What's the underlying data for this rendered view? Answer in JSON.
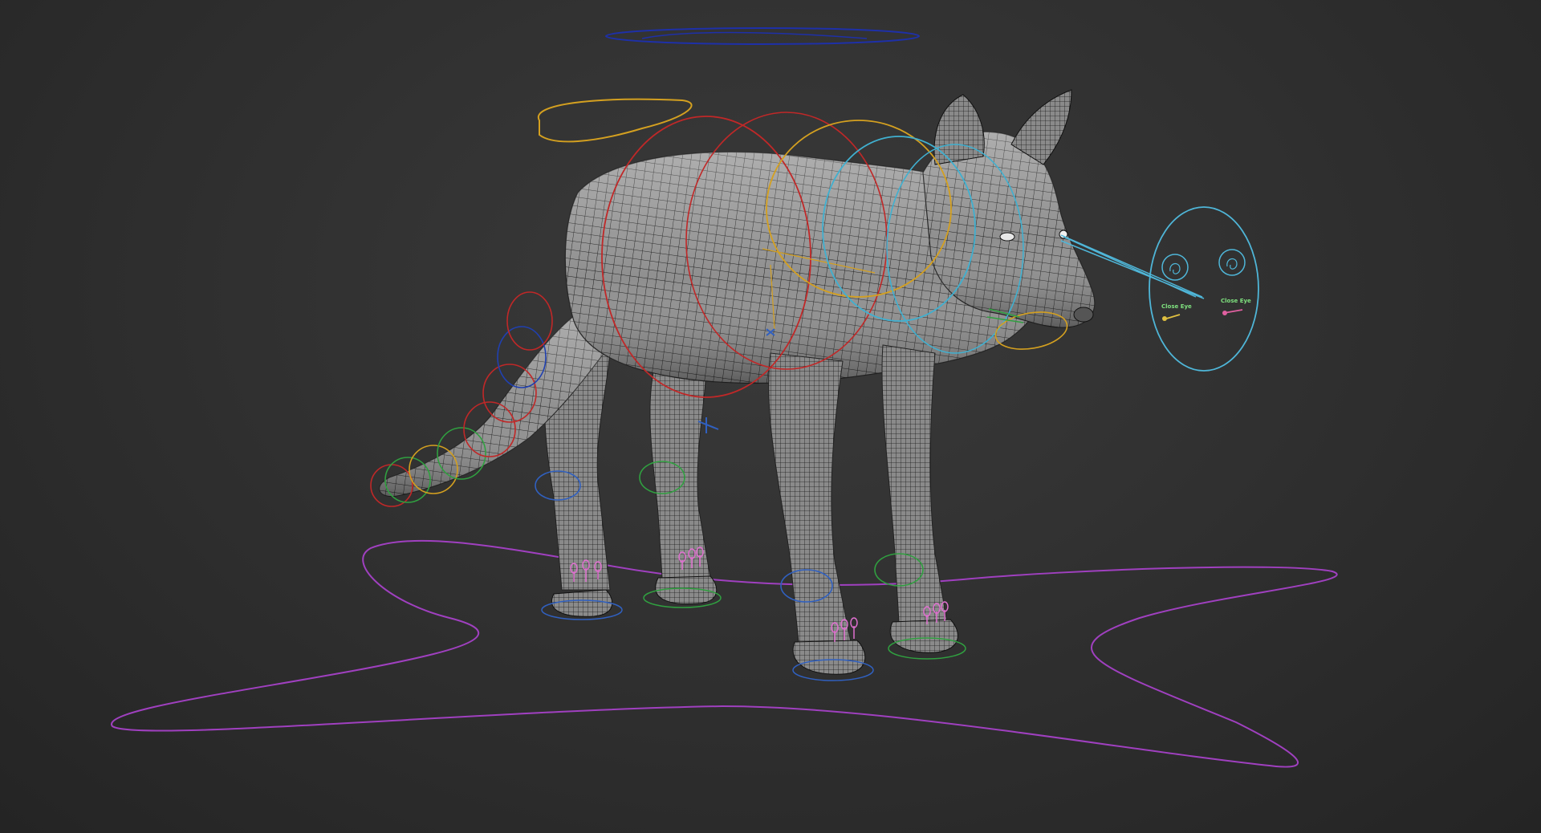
{
  "viewport": {
    "background_top": "#3a3a3a",
    "background_bottom": "#242424"
  },
  "character": {
    "type": "quadruped-rig",
    "mesh_color": "#8c8c8c",
    "wire_color": "#1a1a1a"
  },
  "eye_controller": {
    "close_eye_left_label": "Close Eye",
    "close_eye_right_label": "Close Eye",
    "frame_color": "#4fb6d8",
    "left_label_color": "#7ee07e",
    "right_label_color": "#7ee07e",
    "left_slider_color": "#e0c040",
    "right_slider_color": "#e060a0"
  },
  "controller_colors": {
    "root": "#b050c8",
    "top": "#2030a0",
    "spine_red": "#c02828",
    "spine_yellow": "#d4a020",
    "neck_cyan": "#40b0d0",
    "tail_green": "#30a040",
    "leg_blue": "#3060c0",
    "toe_pink": "#e070d0"
  }
}
